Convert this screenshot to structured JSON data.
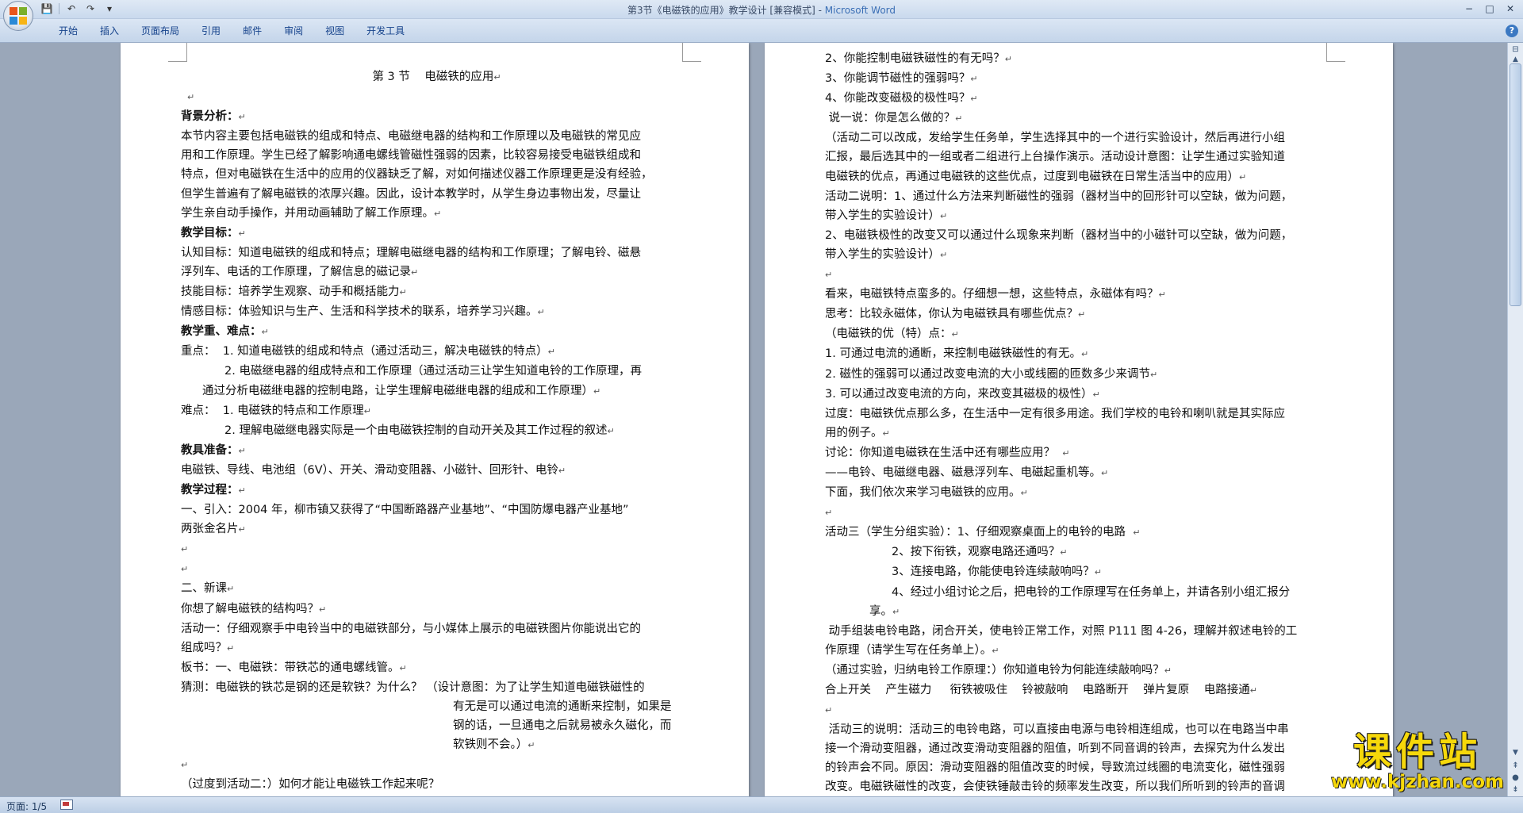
{
  "window": {
    "title_doc": "第3节《电磁铁的应用》教学设计 [兼容模式] - ",
    "title_app": "Microsoft Word",
    "minimize": "−",
    "maximize": "□",
    "close": "✕"
  },
  "qat": {
    "save_icon": "💾",
    "undo_icon": "↶",
    "redo_icon": "↷",
    "customize_icon": "▾"
  },
  "menu": {
    "tabs": [
      "开始",
      "插入",
      "页面布局",
      "引用",
      "邮件",
      "审阅",
      "视图",
      "开发工具"
    ],
    "help_icon": "?"
  },
  "pm": "↵",
  "page1": {
    "title": "第 3 节    电磁铁的应用",
    "lines": [
      "",
      "背景分析：",
      "本节内容主要包括电磁铁的组成和特点、电磁继电器的结构和工作原理以及电磁铁的常见应",
      "用和工作原理。学生已经了解影响通电螺线管磁性强弱的因素，比较容易接受电磁铁组成和",
      "特点，但对电磁铁在生活中的应用的仪器缺乏了解，对如何描述仪器工作原理更是没有经验，",
      "但学生普遍有了解电磁铁的浓厚兴趣。因此，设计本教学时，从学生身边事物出发，尽量让",
      "学生亲自动手操作，并用动画辅助了解工作原理。",
      "教学目标：",
      "认知目标：知道电磁铁的组成和特点；理解电磁继电器的结构和工作原理；了解电铃、磁悬",
      "浮列车、电话的工作原理，了解信息的磁记录",
      "技能目标：培养学生观察、动手和概括能力",
      "情感目标：体验知识与生产、生活和科学技术的联系，培养学习兴趣。",
      "教学重、难点：",
      "重点：  1. 知道电磁铁的组成和特点（通过活动三，解决电磁铁的特点）",
      "2. 电磁继电器的组成特点和工作原理（通过活动三让学生知道电铃的工作原理，再",
      "通过分析电磁继电器的控制电路，让学生理解电磁继电器的组成和工作原理）",
      "难点：  1. 电磁铁的特点和工作原理",
      "2. 理解电磁继电器实际是一个由电磁铁控制的自动开关及其工作过程的叙述",
      "教具准备：",
      "电磁铁、导线、电池组（6V）、开关、滑动变阻器、小磁针、回形针、电铃",
      "教学过程：",
      "一、引入：2004 年，柳市镇又获得了“中国断路器产业基地”、“中国防爆电器产业基地”",
      "两张金名片",
      "",
      "",
      "二、新课",
      "你想了解电磁铁的结构吗？",
      "活动一：仔细观察手中电铃当中的电磁铁部分，与小媒体上展示的电磁铁图片你能说出它的",
      "组成吗？",
      "板书：一、电磁铁：带铁芯的通电螺线管。",
      "猜测：电磁铁的铁芯是钢的还是软铁？为什么？ （设计意图：为了让学生知道电磁铁磁性的",
      "有无是可以通过电流的通断来控制，如果是",
      "钢的话，一旦通电之后就易被永久磁化，而",
      "软铁则不会。）",
      "",
      "（过度到活动二：）如何才能让电磁铁工作起来呢？"
    ]
  },
  "page2": {
    "lines": [
      "2、你能控制电磁铁磁性的有无吗？",
      "3、你能调节磁性的强弱吗？",
      "4、你能改变磁极的极性吗？",
      " 说一说：你是怎么做的？",
      "（活动二可以改成，发给学生任务单，学生选择其中的一个进行实验设计，然后再进行小组",
      "汇报，最后选其中的一组或者二组进行上台操作演示。活动设计意图：让学生通过实验知道",
      "电磁铁的优点，再通过电磁铁的这些优点，过度到电磁铁在日常生活当中的应用）",
      "活动二说明：1、通过什么方法来判断磁性的强弱（器材当中的回形针可以空缺，做为问题，",
      "带入学生的实验设计）",
      "2、电磁铁极性的改变又可以通过什么现象来判断（器材当中的小磁针可以空缺，做为问题，",
      "带入学生的实验设计）",
      "",
      "看来，电磁铁特点蛮多的。仔细想一想，这些特点，永磁体有吗？",
      "思考：比较永磁体，你认为电磁铁具有哪些优点？",
      "（电磁铁的优（特）点：",
      "1. 可通过电流的通断，来控制电磁铁磁性的有无。",
      "2. 磁性的强弱可以通过改变电流的大小或线圈的匝数多少来调节",
      "3. 可以通过改变电流的方向，来改变其磁极的极性）",
      "过度：电磁铁优点那么多，在生活中一定有很多用途。我们学校的电铃和喇叭就是其实际应",
      "用的例子。",
      "讨论：你知道电磁铁在生活中还有哪些应用？  ",
      "——电铃、电磁继电器、磁悬浮列车、电磁起重机等。",
      "下面，我们依次来学习电磁铁的应用。",
      "",
      "活动三（学生分组实验）：1、仔细观察桌面上的电铃的电路  ",
      "2、按下衔铁，观察电路还通吗？",
      "3、连接电路，你能使电铃连续敲响吗？",
      "4、经过小组讨论之后，把电铃的工作原理写在任务单上，并请各别小组汇报分",
      "享。",
      " 动手组装电铃电路，闭合开关，使电铃正常工作，对照 P111 图 4-26，理解并叙述电铃的工",
      "作原理（请学生写在任务单上）。",
      "（通过实验，归纳电铃工作原理：）你知道电铃为何能连续敲响吗？",
      "合上开关    产生磁力     衔铁被吸住    铃被敲响    电路断开    弹片复原    电路接通",
      "",
      " 活动三的说明：活动三的电铃电路，可以直接由电源与电铃相连组成，也可以在电路当中串",
      "接一个滑动变阻器，通过改变滑动变阻器的阻值，听到不同音调的铃声，去探究为什么发出",
      "的铃声会不同。原因：滑动变阻器的阻值改变的时候，导致流过线圈的电流变化，磁性强弱",
      "改变。电磁铁磁性的改变，会使铁锤敲击铃的频率发生改变，所以我们所听到的铃声的音调"
    ]
  },
  "status": {
    "page_indicator": "页面: 1/5"
  },
  "watermark": {
    "main": "课件站",
    "url": "www.kjzhan.com"
  }
}
